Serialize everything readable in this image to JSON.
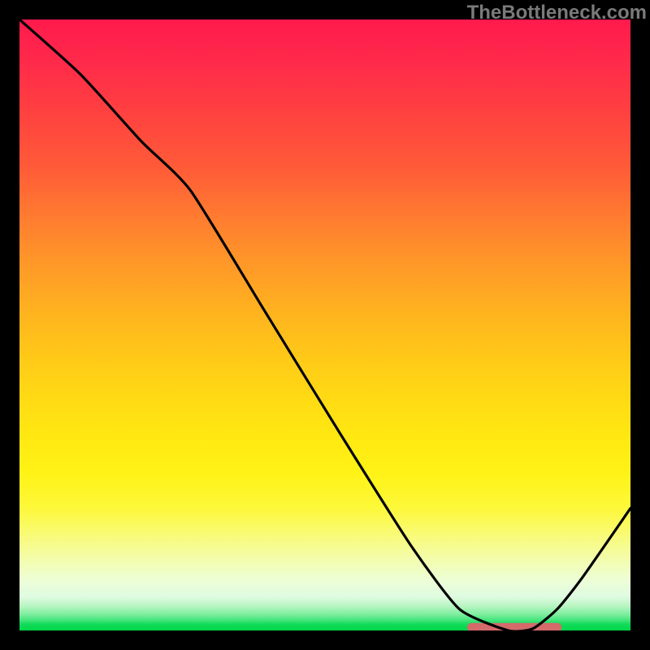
{
  "watermark": "TheBottleneck.com",
  "colors": {
    "marker": "#d46a6a",
    "curve": "#000000",
    "gradient_top": "#ff1a4d",
    "gradient_mid": "#ffda14",
    "gradient_bottom": "#00d648"
  },
  "chart_data": {
    "type": "line",
    "title": "",
    "xlabel": "",
    "ylabel": "",
    "xlim": [
      0,
      100
    ],
    "ylim": [
      0,
      100
    ],
    "series": [
      {
        "name": "bottleneck-curve",
        "x": [
          0,
          10,
          20,
          28,
          40,
          52,
          64,
          72,
          80,
          84,
          88,
          92,
          100
        ],
        "values": [
          100,
          91,
          80,
          72,
          52.5,
          33,
          14,
          3.5,
          0,
          0.3,
          3.5,
          8.5,
          20
        ]
      }
    ],
    "marker": {
      "x_start": 74,
      "x_end": 88,
      "y": 0.5
    }
  }
}
